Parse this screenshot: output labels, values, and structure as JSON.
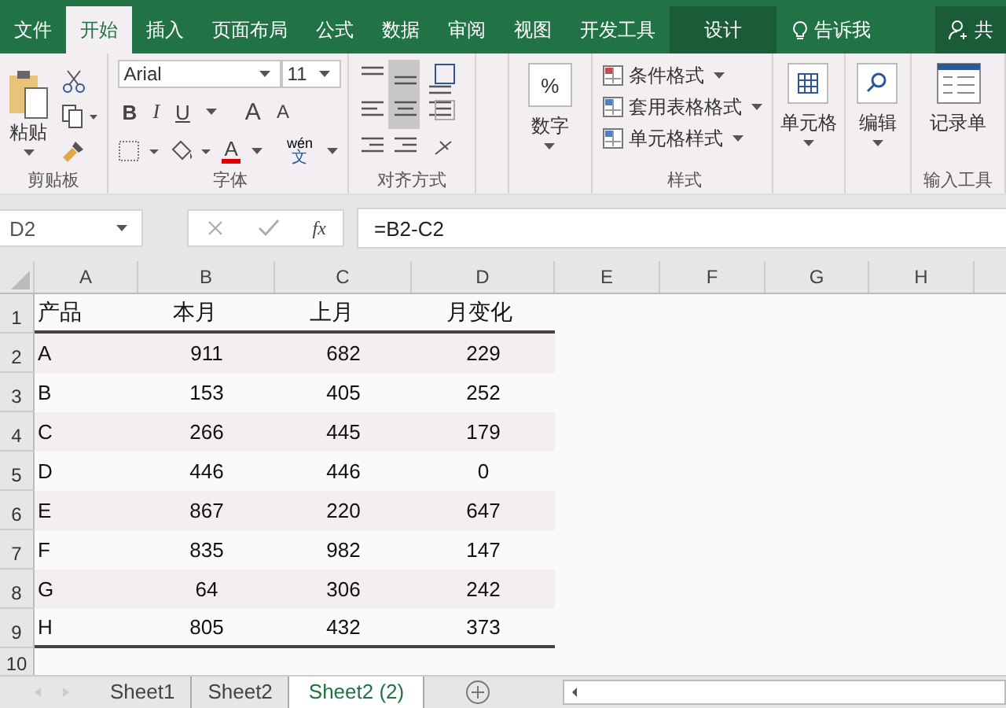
{
  "tabs": [
    {
      "label": "文件",
      "selected": false,
      "contextual": false
    },
    {
      "label": "开始",
      "selected": true,
      "contextual": false
    },
    {
      "label": "插入",
      "selected": false,
      "contextual": false
    },
    {
      "label": "页面布局",
      "selected": false,
      "contextual": false
    },
    {
      "label": "公式",
      "selected": false,
      "contextual": false
    },
    {
      "label": "数据",
      "selected": false,
      "contextual": false
    },
    {
      "label": "审阅",
      "selected": false,
      "contextual": false
    },
    {
      "label": "视图",
      "selected": false,
      "contextual": false
    },
    {
      "label": "开发工具",
      "selected": false,
      "contextual": false
    },
    {
      "label": "设计",
      "selected": false,
      "contextual": true
    }
  ],
  "tell_me": "告诉我",
  "share": "共",
  "ribbon": {
    "clipboard": {
      "paste": "粘贴",
      "label": "剪贴板"
    },
    "font": {
      "name": "Arial",
      "size": "11",
      "styles": [
        "B",
        "I",
        "U"
      ],
      "grow": "A",
      "shrink": "A",
      "color_letter": "A",
      "phonetic_top": "wén",
      "phonetic_bottom": "文",
      "label": "字体"
    },
    "alignment": {
      "label": "对齐方式"
    },
    "number": {
      "symbol": "%",
      "label": "数字"
    },
    "styles": {
      "items": [
        "条件格式",
        "套用表格格式",
        "单元格样式"
      ],
      "label": "样式"
    },
    "cells": {
      "label": "单元格"
    },
    "editing": {
      "label": "编辑"
    },
    "form": {
      "button": "记录单",
      "label": "输入工具"
    }
  },
  "name_box": "D2",
  "fx": "fx",
  "formula": "=B2-C2",
  "columns": [
    "A",
    "B",
    "C",
    "D",
    "E",
    "F",
    "G",
    "H"
  ],
  "header": {
    "row": "1",
    "cells": [
      "产品",
      "本月",
      "上月",
      "月变化"
    ]
  },
  "rows": [
    {
      "row": "2",
      "shaded": true,
      "cells": [
        "A",
        "911",
        "682",
        "229"
      ]
    },
    {
      "row": "3",
      "shaded": false,
      "cells": [
        "B",
        "153",
        "405",
        "252"
      ]
    },
    {
      "row": "4",
      "shaded": true,
      "cells": [
        "C",
        "266",
        "445",
        "179"
      ]
    },
    {
      "row": "5",
      "shaded": false,
      "cells": [
        "D",
        "446",
        "446",
        "0"
      ]
    },
    {
      "row": "6",
      "shaded": true,
      "cells": [
        "E",
        "867",
        "220",
        "647"
      ]
    },
    {
      "row": "7",
      "shaded": false,
      "cells": [
        "F",
        "835",
        "982",
        "147"
      ]
    },
    {
      "row": "8",
      "shaded": true,
      "cells": [
        "G",
        "64",
        "306",
        "242"
      ]
    },
    {
      "row": "9",
      "shaded": false,
      "cells": [
        "H",
        "805",
        "432",
        "373"
      ]
    }
  ],
  "empty_rows": [
    "10"
  ],
  "sheets": [
    {
      "label": "Sheet1",
      "selected": false
    },
    {
      "label": "Sheet2",
      "selected": false
    },
    {
      "label": "Sheet2 (2)",
      "selected": true
    }
  ]
}
